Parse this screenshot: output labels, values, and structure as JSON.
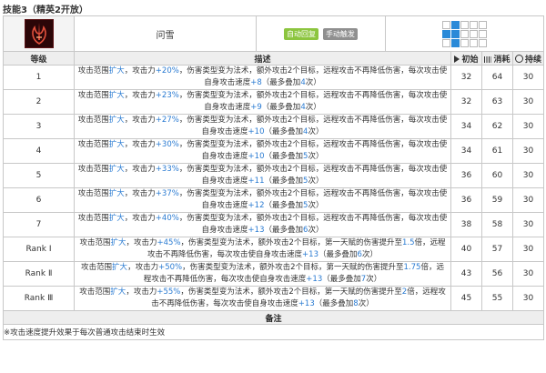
{
  "title": "技能3（精英2开放）",
  "skill": {
    "name": "问雪",
    "tags": [
      "自动回复",
      "手动触发"
    ],
    "range_grid": [
      [
        0,
        1,
        0,
        0,
        0
      ],
      [
        1,
        1,
        0,
        0,
        0
      ],
      [
        0,
        1,
        0,
        0,
        0
      ]
    ]
  },
  "colors": {
    "tag_auto": "#8cc53f",
    "tag_manual": "#8f8f8f",
    "range_blue": "#2a8ad8",
    "highlight": "#2a7bd2"
  },
  "headers": {
    "level": "等级",
    "desc": "描述",
    "initial": "初始",
    "cost": "消耗",
    "duration": "持续"
  },
  "header_icons": {
    "initial": "play-icon",
    "cost": "bars-icon",
    "duration": "clock-icon"
  },
  "rows": [
    {
      "level": "1",
      "initial": "32",
      "cost": "64",
      "duration": "30",
      "desc": [
        [
          "攻击范围",
          ""
        ],
        [
          "扩大",
          "b"
        ],
        [
          "，攻击力",
          ""
        ],
        [
          "+20%",
          "b"
        ],
        [
          "，伤害类型变为法术，额外攻击2个目标，远程攻击不再降低伤害，每次攻击使自身攻击速度",
          ""
        ],
        [
          "+8",
          "b"
        ],
        [
          "（最多叠加",
          ""
        ],
        [
          "4",
          "b"
        ],
        [
          "次）",
          ""
        ]
      ]
    },
    {
      "level": "2",
      "initial": "32",
      "cost": "63",
      "duration": "30",
      "desc": [
        [
          "攻击范围",
          ""
        ],
        [
          "扩大",
          "b"
        ],
        [
          "，攻击力",
          ""
        ],
        [
          "+23%",
          "b"
        ],
        [
          "，伤害类型变为法术，额外攻击2个目标，远程攻击不再降低伤害，每次攻击使自身攻击速度",
          ""
        ],
        [
          "+9",
          "b"
        ],
        [
          "（最多叠加",
          ""
        ],
        [
          "4",
          "b"
        ],
        [
          "次）",
          ""
        ]
      ]
    },
    {
      "level": "3",
      "initial": "34",
      "cost": "62",
      "duration": "30",
      "desc": [
        [
          "攻击范围",
          ""
        ],
        [
          "扩大",
          "b"
        ],
        [
          "，攻击力",
          ""
        ],
        [
          "+27%",
          "b"
        ],
        [
          "，伤害类型变为法术，额外攻击2个目标，远程攻击不再降低伤害，每次攻击使自身攻击速度",
          ""
        ],
        [
          "+10",
          "b"
        ],
        [
          "（最多叠加",
          ""
        ],
        [
          "4",
          "b"
        ],
        [
          "次）",
          ""
        ]
      ]
    },
    {
      "level": "4",
      "initial": "34",
      "cost": "61",
      "duration": "30",
      "desc": [
        [
          "攻击范围",
          ""
        ],
        [
          "扩大",
          "b"
        ],
        [
          "，攻击力",
          ""
        ],
        [
          "+30%",
          "b"
        ],
        [
          "，伤害类型变为法术，额外攻击2个目标，远程攻击不再降低伤害，每次攻击使自身攻击速度",
          ""
        ],
        [
          "+10",
          "b"
        ],
        [
          "（最多叠加",
          ""
        ],
        [
          "5",
          "b"
        ],
        [
          "次）",
          ""
        ]
      ]
    },
    {
      "level": "5",
      "initial": "36",
      "cost": "60",
      "duration": "30",
      "desc": [
        [
          "攻击范围",
          ""
        ],
        [
          "扩大",
          "b"
        ],
        [
          "，攻击力",
          ""
        ],
        [
          "+33%",
          "b"
        ],
        [
          "，伤害类型变为法术，额外攻击2个目标，远程攻击不再降低伤害，每次攻击使自身攻击速度",
          ""
        ],
        [
          "+11",
          "b"
        ],
        [
          "（最多叠加",
          ""
        ],
        [
          "5",
          "b"
        ],
        [
          "次）",
          ""
        ]
      ]
    },
    {
      "level": "6",
      "initial": "36",
      "cost": "59",
      "duration": "30",
      "desc": [
        [
          "攻击范围",
          ""
        ],
        [
          "扩大",
          "b"
        ],
        [
          "，攻击力",
          ""
        ],
        [
          "+37%",
          "b"
        ],
        [
          "，伤害类型变为法术，额外攻击2个目标，远程攻击不再降低伤害，每次攻击使自身攻击速度",
          ""
        ],
        [
          "+12",
          "b"
        ],
        [
          "（最多叠加",
          ""
        ],
        [
          "5",
          "b"
        ],
        [
          "次）",
          ""
        ]
      ]
    },
    {
      "level": "7",
      "initial": "38",
      "cost": "58",
      "duration": "30",
      "desc": [
        [
          "攻击范围",
          ""
        ],
        [
          "扩大",
          "b"
        ],
        [
          "，攻击力",
          ""
        ],
        [
          "+40%",
          "b"
        ],
        [
          "，伤害类型变为法术，额外攻击2个目标，远程攻击不再降低伤害，每次攻击使自身攻击速度",
          ""
        ],
        [
          "+13",
          "b"
        ],
        [
          "（最多叠加",
          ""
        ],
        [
          "6",
          "b"
        ],
        [
          "次）",
          ""
        ]
      ]
    },
    {
      "level": "Rank Ⅰ",
      "initial": "40",
      "cost": "57",
      "duration": "30",
      "desc": [
        [
          "攻击范围",
          ""
        ],
        [
          "扩大",
          "b"
        ],
        [
          "，攻击力",
          ""
        ],
        [
          "+45%",
          "b"
        ],
        [
          "，伤害类型变为法术，额外攻击2个目标，第一天赋的伤害提升至",
          ""
        ],
        [
          "1.5",
          "b"
        ],
        [
          "倍，远程攻击不再降低伤害，每次攻击使自身攻击速度",
          ""
        ],
        [
          "+13",
          "b"
        ],
        [
          "（最多叠加",
          ""
        ],
        [
          "6",
          "b"
        ],
        [
          "次）",
          ""
        ]
      ]
    },
    {
      "level": "Rank Ⅱ",
      "initial": "43",
      "cost": "56",
      "duration": "30",
      "desc": [
        [
          "攻击范围",
          ""
        ],
        [
          "扩大",
          "b"
        ],
        [
          "，攻击力",
          ""
        ],
        [
          "+50%",
          "b"
        ],
        [
          "，伤害类型变为法术，额外攻击2个目标，第一天赋的伤害提升至",
          ""
        ],
        [
          "1.75",
          "b"
        ],
        [
          "倍，远程攻击不再降低伤害，每次攻击使自身攻击速度",
          ""
        ],
        [
          "+13",
          "b"
        ],
        [
          "（最多叠加",
          ""
        ],
        [
          "7",
          "b"
        ],
        [
          "次）",
          ""
        ]
      ]
    },
    {
      "level": "Rank Ⅲ",
      "initial": "45",
      "cost": "55",
      "duration": "30",
      "desc": [
        [
          "攻击范围",
          ""
        ],
        [
          "扩大",
          "b"
        ],
        [
          "，攻击力",
          ""
        ],
        [
          "+55%",
          "b"
        ],
        [
          "，伤害类型变为法术，额外攻击2个目标，第一天赋的伤害提升至",
          ""
        ],
        [
          "2",
          "b"
        ],
        [
          "倍，远程攻击不再降低伤害，每次攻击使自身攻击速度",
          ""
        ],
        [
          "+13",
          "b"
        ],
        [
          "（最多叠加",
          ""
        ],
        [
          "8",
          "b"
        ],
        [
          "次）",
          ""
        ]
      ]
    }
  ],
  "note": {
    "head": "备注",
    "text": "※攻击速度提升效果于每次普通攻击结束时生效"
  }
}
